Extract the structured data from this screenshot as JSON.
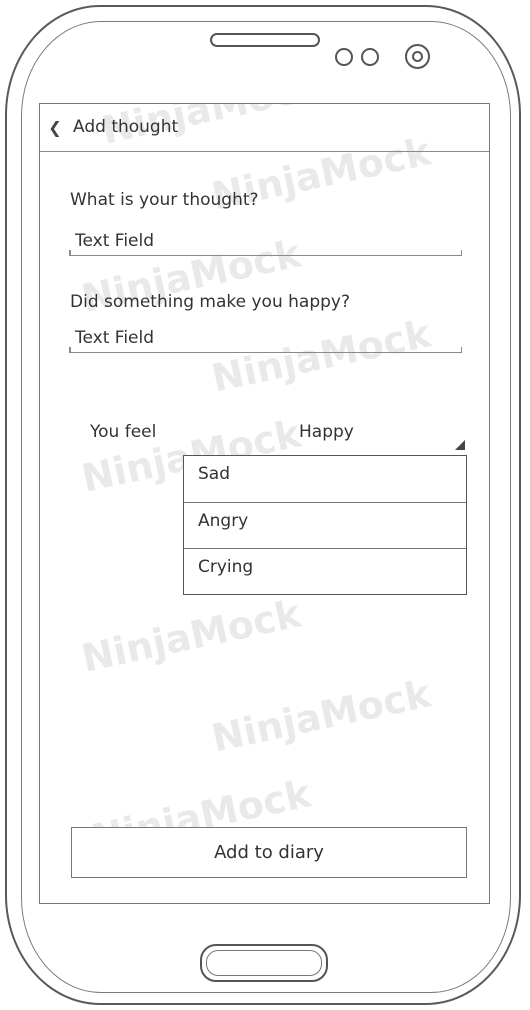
{
  "app_bar": {
    "title": "Add thought",
    "back_icon": "chevron-left-icon"
  },
  "thought_field": {
    "label": "What is your thought?",
    "value": "Text Field"
  },
  "happy_field": {
    "label": "Did something make you happy?",
    "value": "Text Field"
  },
  "mood": {
    "label": "You feel",
    "selected": "Happy",
    "options": [
      "Sad",
      "Angry",
      "Crying"
    ]
  },
  "add_button": {
    "label": "Add to diary"
  },
  "watermark": {
    "text": "NinjaMock"
  }
}
